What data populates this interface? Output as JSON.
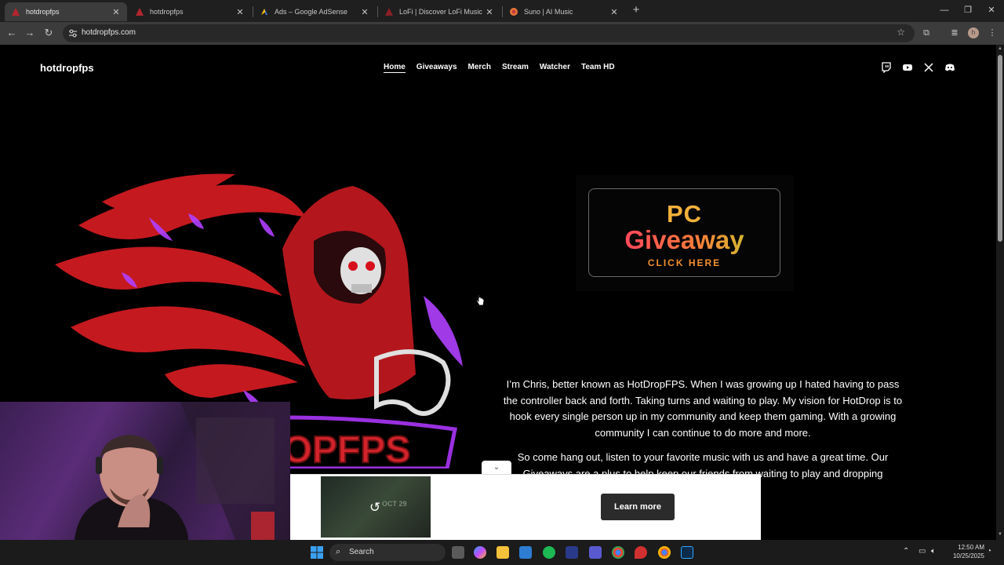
{
  "browser": {
    "tabs": [
      {
        "title": "hotdropfps",
        "active": true,
        "favicon": "hotdropfps-icon"
      },
      {
        "title": "hotdropfps",
        "active": false,
        "favicon": "hotdropfps-icon"
      },
      {
        "title": "Ads – Google AdSense",
        "active": false,
        "favicon": "adsense-icon"
      },
      {
        "title": "LoFi | Discover LoFi Music Now",
        "active": false,
        "favicon": "lofi-icon"
      },
      {
        "title": "Suno | AI Music",
        "active": false,
        "favicon": "suno-icon"
      }
    ],
    "url": "hotdropfps.com",
    "profile_initial": "h"
  },
  "site": {
    "brand": "hotdropfps",
    "nav": [
      "Home",
      "Giveaways",
      "Merch",
      "Stream",
      "Watcher",
      "Team HD"
    ],
    "active_nav": "Home",
    "social_icons": [
      "twitch-icon",
      "youtube-icon",
      "x-icon",
      "discord-icon"
    ],
    "logo_text": "HOTDROPFPS",
    "promo": {
      "line1": "PC",
      "line2": "Giveaway",
      "line3": "CLICK HERE"
    },
    "about": [
      "I’m Chris, better known as HotDropFPS. When I was growing up I hated having to pass the controller back and forth. Taking turns and waiting to play. My vision for HotDrop is to hook every single person up in my community and keep them gaming. With a growing community I can continue to do more and more.",
      "So come hang out, listen to your favorite music with us and have a great time. Our Giveaways are a plus to help keep our friends from waiting to play and dropping"
    ]
  },
  "ad": {
    "cta": "Learn more",
    "thumb_text": "OCT 29"
  },
  "taskbar": {
    "search_label": "Search",
    "time": "12:50 AM",
    "date": "10/25/2025"
  },
  "colors": {
    "accent_red": "#d2232a",
    "promo_orange": "#f2b13b",
    "page_bg": "#000000"
  }
}
